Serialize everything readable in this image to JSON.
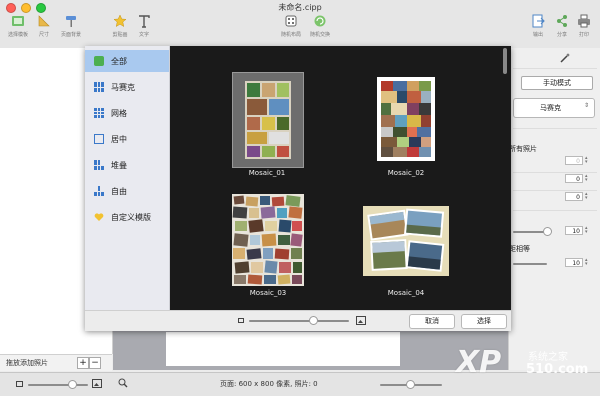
{
  "window": {
    "title": "未命名.cipp"
  },
  "toolbar": {
    "left_buttons": [
      {
        "label": "选择模板",
        "icon": "template-icon"
      },
      {
        "label": "尺寸",
        "icon": "ruler-triangle-icon"
      },
      {
        "label": "页面背景",
        "icon": "paint-roller-icon"
      },
      {
        "label": "剪贴画",
        "icon": "star-icon"
      },
      {
        "label": "文字",
        "icon": "text-icon"
      }
    ],
    "center_buttons": [
      {
        "label": "随机布局",
        "icon": "dice-icon"
      },
      {
        "label": "随机交换",
        "icon": "shuffle-icon"
      }
    ],
    "right_buttons": [
      {
        "label": "输出",
        "icon": "export-icon"
      },
      {
        "label": "分享",
        "icon": "share-icon"
      },
      {
        "label": "打印",
        "icon": "printer-icon"
      }
    ]
  },
  "template_sheet": {
    "categories": [
      {
        "label": "全部",
        "icon": "all-icon",
        "selected": true
      },
      {
        "label": "马赛克",
        "icon": "mosaic-icon",
        "selected": false
      },
      {
        "label": "网格",
        "icon": "grid-icon",
        "selected": false
      },
      {
        "label": "居中",
        "icon": "center-icon",
        "selected": false
      },
      {
        "label": "堆叠",
        "icon": "stack-icon",
        "selected": false
      },
      {
        "label": "自由",
        "icon": "free-icon",
        "selected": false
      },
      {
        "label": "自定义模版",
        "icon": "heart-icon",
        "selected": false
      }
    ],
    "templates": [
      {
        "name": "Mosaic_01",
        "selected": true
      },
      {
        "name": "Mosaic_02",
        "selected": false
      },
      {
        "name": "Mosaic_03",
        "selected": false
      },
      {
        "name": "Mosaic_04",
        "selected": false
      }
    ],
    "cancel_label": "取消",
    "choose_label": "选择"
  },
  "inspector": {
    "mode_button": "手动模式",
    "layout_select": "马赛克",
    "all_photos_fragment": "所有照片",
    "spacing_fragment": "距相等",
    "steppers": [
      "0",
      "0",
      "0",
      "10",
      "10"
    ]
  },
  "sidebar": {
    "add_photos_label": "拖放添加照片",
    "add_symbol": "+",
    "remove_symbol": "−"
  },
  "statusbar": {
    "page_info": "页面: 600 x 800 像素, 照片: 0"
  },
  "watermark": {
    "brand": "XP",
    "site": "系统之家",
    "domain": "510.com"
  },
  "colors": {
    "selection": "#a9c9ef",
    "accent_blue": "#3a78c9",
    "sheet_bg": "#1a1a1a"
  }
}
